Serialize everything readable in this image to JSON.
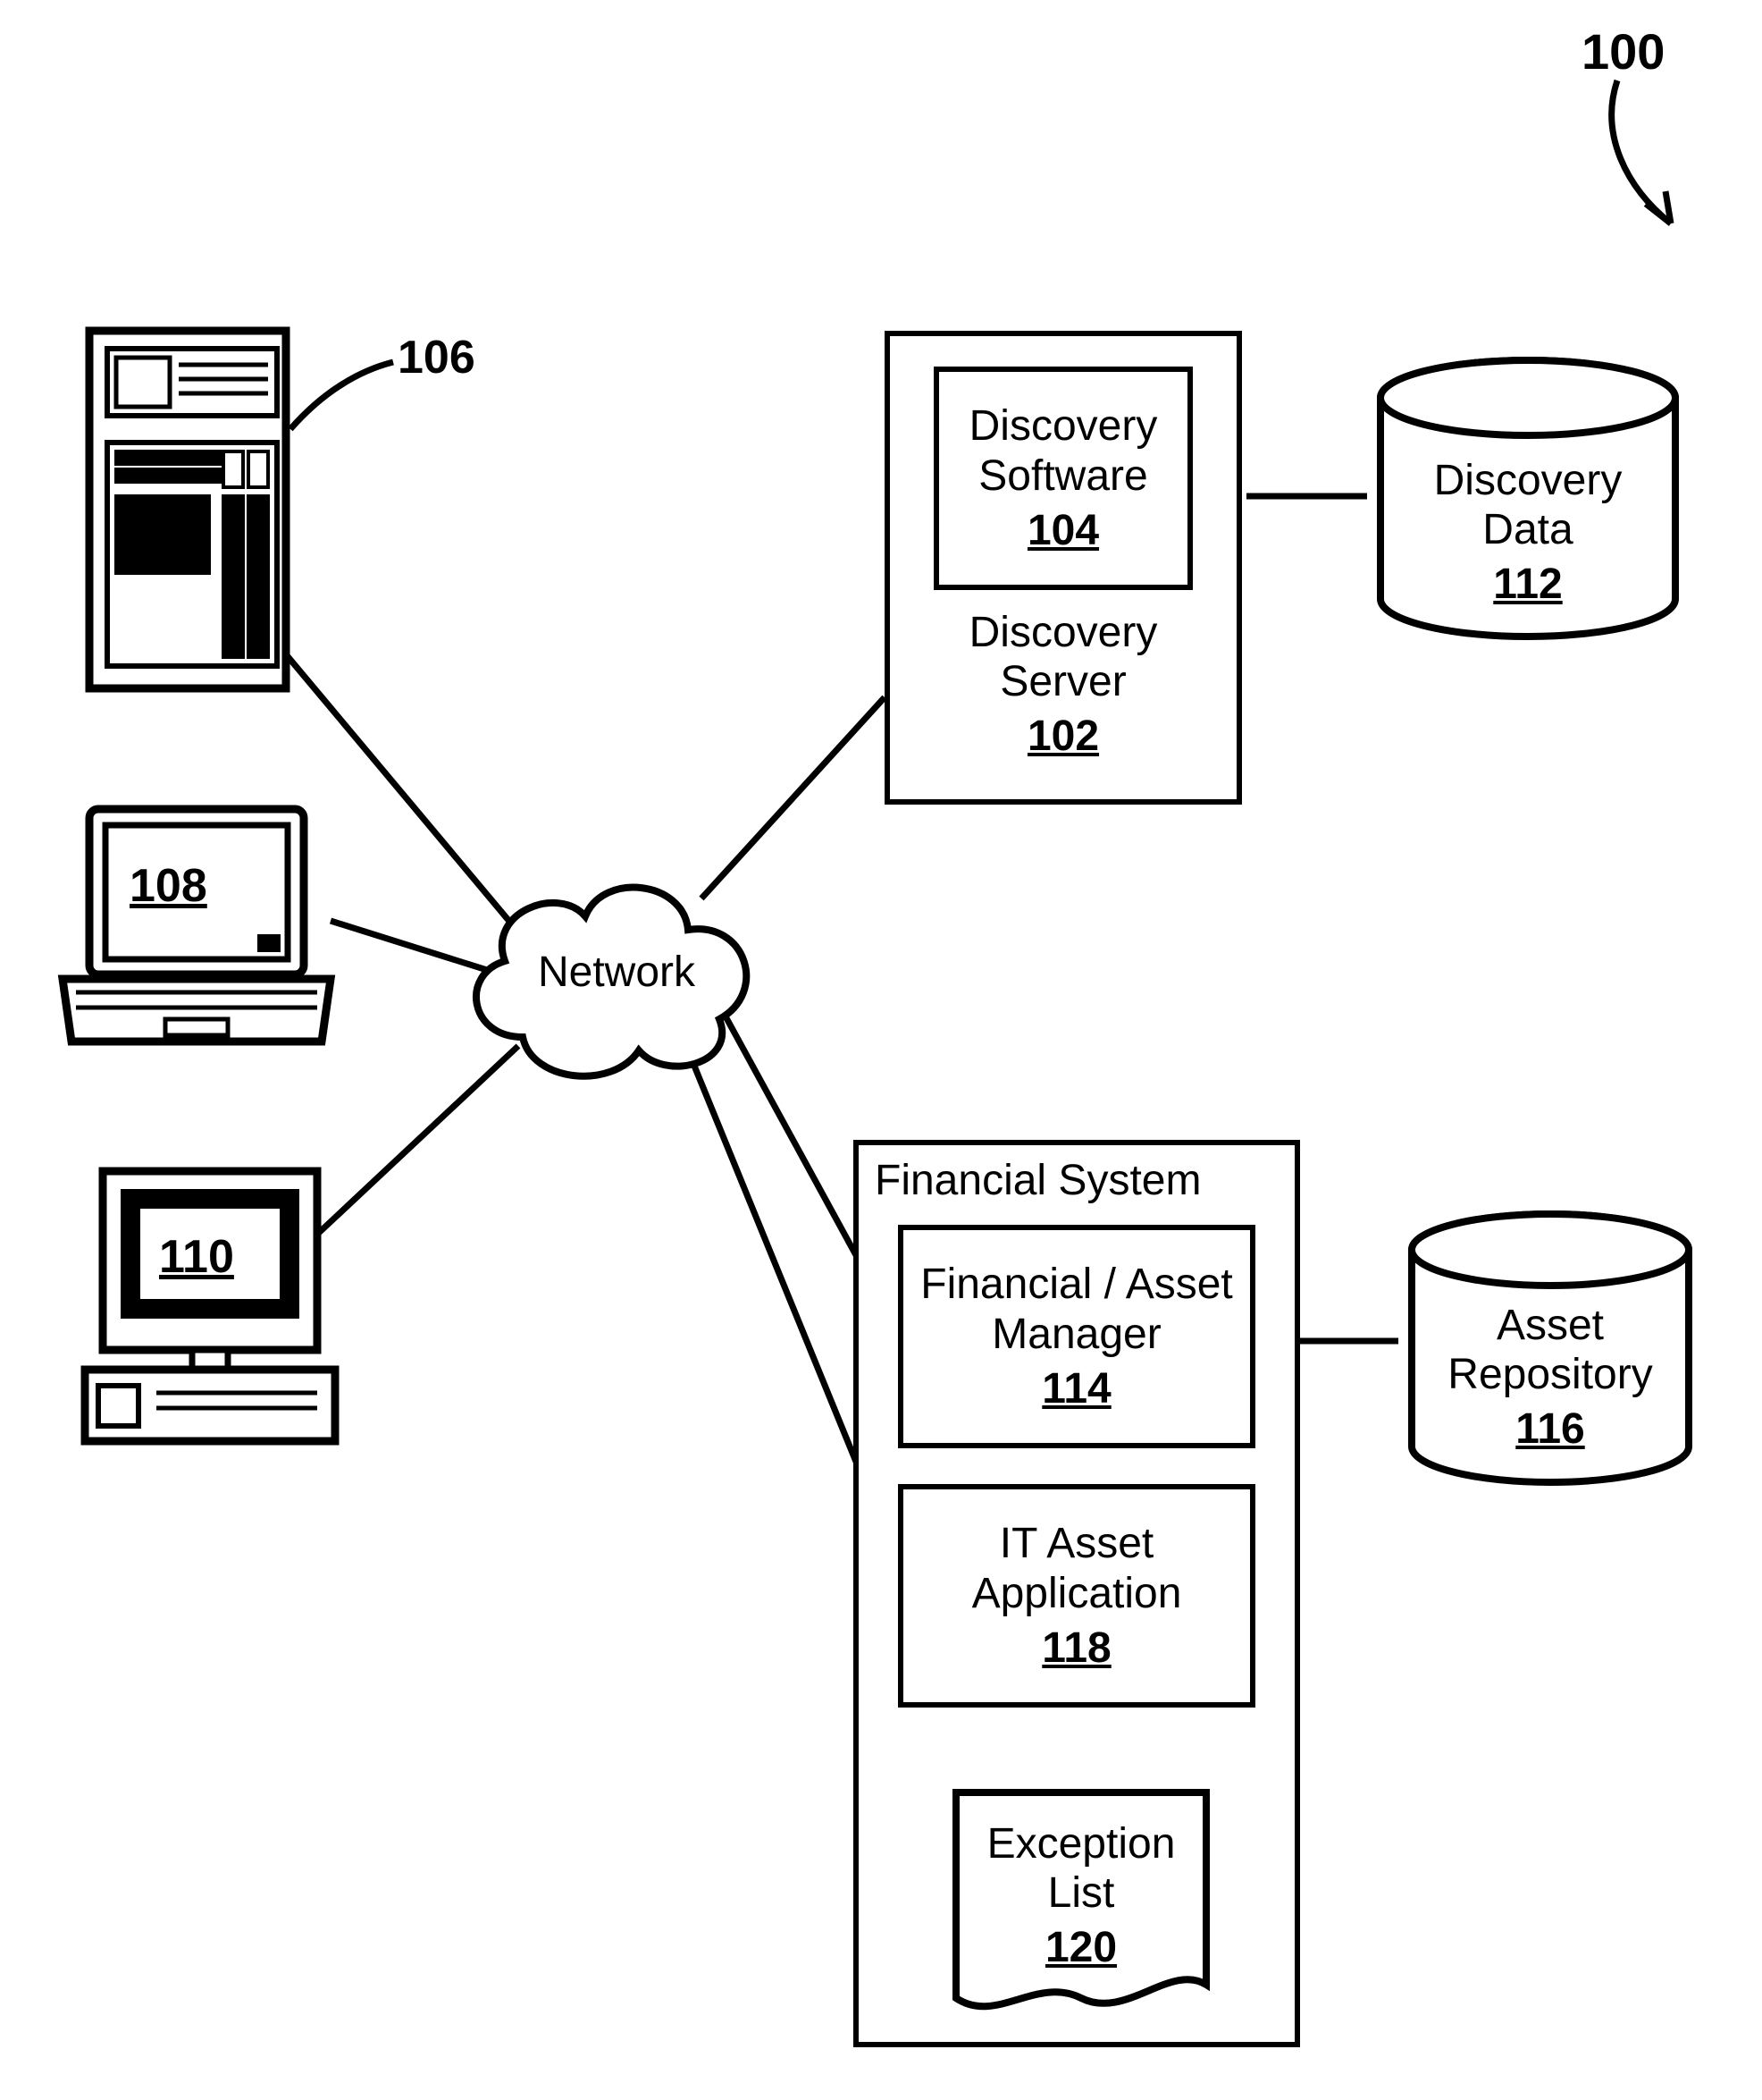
{
  "figure_ref": "100",
  "network": {
    "label": "Network"
  },
  "devices": {
    "mainframe": {
      "ref": "106"
    },
    "laptop": {
      "ref": "108"
    },
    "desktop": {
      "ref": "110"
    }
  },
  "discovery_server": {
    "label1": "Discovery",
    "label2": "Server",
    "ref": "102",
    "software": {
      "label1": "Discovery",
      "label2": "Software",
      "ref": "104"
    }
  },
  "discovery_data": {
    "label1": "Discovery",
    "label2": "Data",
    "ref": "112"
  },
  "financial_system": {
    "title": "Financial System",
    "manager": {
      "label1": "Financial / Asset",
      "label2": "Manager",
      "ref": "114"
    },
    "it_app": {
      "label1": "IT Asset",
      "label2": "Application",
      "ref": "118"
    },
    "exception": {
      "label1": "Exception",
      "label2": "List",
      "ref": "120"
    }
  },
  "asset_repo": {
    "label1": "Asset",
    "label2": "Repository",
    "ref": "116"
  }
}
